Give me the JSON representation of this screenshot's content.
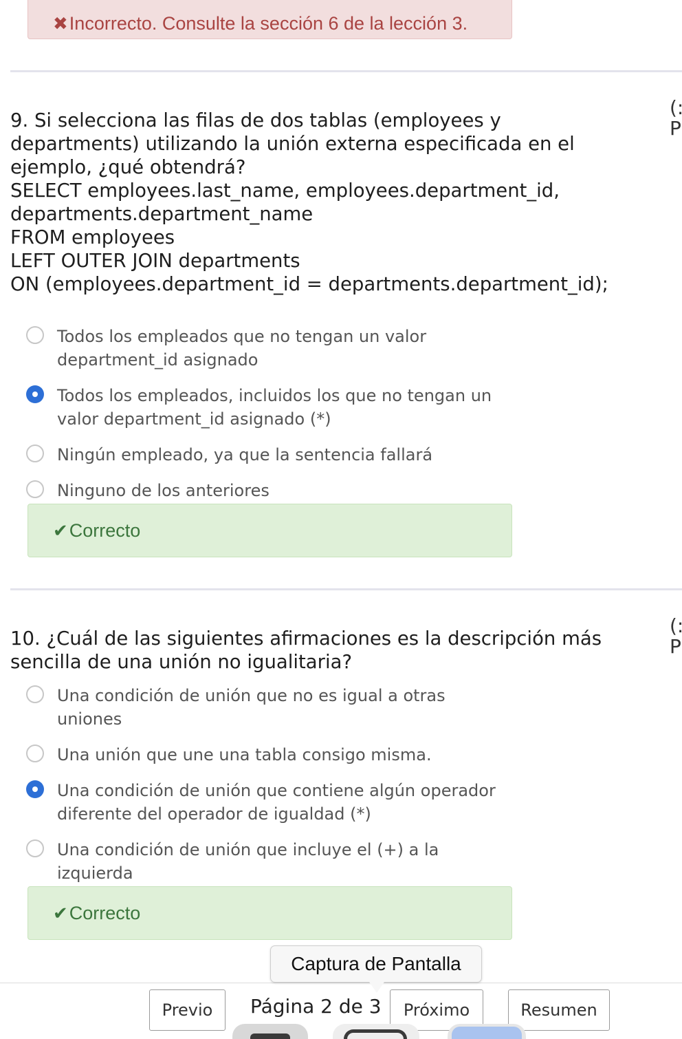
{
  "top_feedback": {
    "icon": "x-mark-icon",
    "text": "Incorrecto. Consulte la sección 6 de la lección 3."
  },
  "question9": {
    "lines": [
      "9. Si selecciona las filas de dos tablas (employees y",
      "departments) utilizando la unión externa especificada en el",
      "ejemplo, ¿qué obtendrá?",
      "SELECT employees.last_name, employees.department_id,",
      "departments.department_name",
      "FROM employees",
      "LEFT OUTER JOIN departments",
      "ON (employees.department_id = departments.department_id);"
    ],
    "side_marks": [
      "(:",
      "P"
    ],
    "options": [
      {
        "lines": [
          "Todos los empleados que no tengan un valor",
          "department_id asignado"
        ],
        "selected": false
      },
      {
        "lines": [
          "Todos los empleados, incluidos los que no tengan un",
          "valor department_id asignado (*)"
        ],
        "selected": true
      },
      {
        "lines": [
          "Ningún empleado, ya que la sentencia fallará"
        ],
        "selected": false
      },
      {
        "lines": [
          "Ninguno de los anteriores"
        ],
        "selected": false
      }
    ],
    "feedback": {
      "icon": "check-mark-icon",
      "text": "Correcto"
    }
  },
  "question10": {
    "lines": [
      "10. ¿Cuál de las siguientes afirmaciones es la descripción más",
      "sencilla de una unión no igualitaria?"
    ],
    "side_marks": [
      "(:",
      "P"
    ],
    "options": [
      {
        "lines": [
          "Una condición de unión que no es igual a otras",
          "uniones"
        ],
        "selected": false
      },
      {
        "lines": [
          "Una unión que une una tabla consigo misma."
        ],
        "selected": false
      },
      {
        "lines": [
          "Una condición de unión que contiene algún operador",
          "diferente del operador de igualdad (*)"
        ],
        "selected": true
      },
      {
        "lines": [
          "Una condición de unión que incluye el (+) a la",
          "izquierda"
        ],
        "selected": false
      }
    ],
    "feedback": {
      "icon": "check-mark-icon",
      "text": "Correcto"
    }
  },
  "tooltip": {
    "text": "Captura de Pantalla"
  },
  "navigation": {
    "prev_label": "Previo",
    "page_indicator": "Página 2 de 3",
    "next_label": "Próximo",
    "summary_label": "Resumen"
  },
  "colors": {
    "danger_bg": "#f2dede",
    "danger_text": "#a94442",
    "success_bg": "#dff0d8",
    "success_text": "#3c763d",
    "radio_checked": "#2d6fd6"
  }
}
